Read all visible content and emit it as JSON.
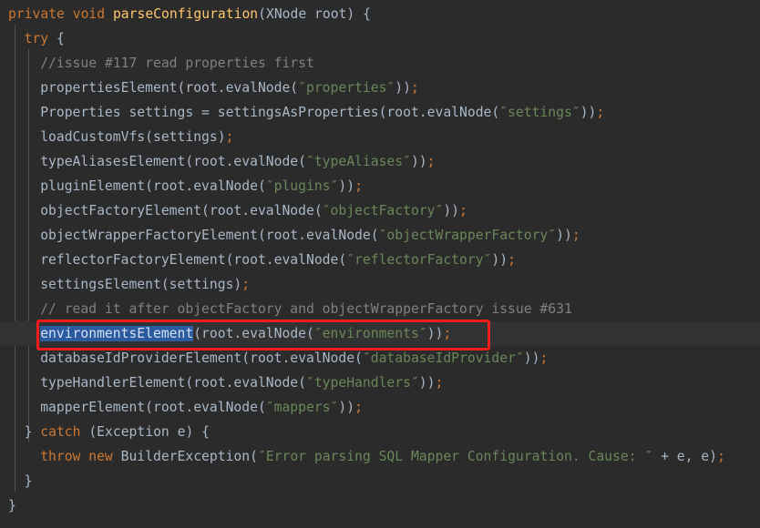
{
  "editor": {
    "theme": "darcula",
    "language": "java",
    "background_color": "#2b2b2b",
    "current_line_color": "#323232",
    "selection_color": "#2b5b9e",
    "annotation_color": "#f01d1d",
    "lines": [
      {
        "indent": 0,
        "tokens": [
          {
            "text": "private",
            "kind": "keyword"
          },
          {
            "text": " ",
            "kind": "plain"
          },
          {
            "text": "void",
            "kind": "keyword"
          },
          {
            "text": " ",
            "kind": "plain"
          },
          {
            "text": "parseConfiguration",
            "kind": "function"
          },
          {
            "text": "(XNode root) {",
            "kind": "plain"
          }
        ]
      },
      {
        "indent": 1,
        "tokens": [
          {
            "text": "try",
            "kind": "keyword"
          },
          {
            "text": " {",
            "kind": "plain"
          }
        ]
      },
      {
        "indent": 2,
        "tokens": [
          {
            "text": "//issue #117 read properties first",
            "kind": "comment"
          }
        ]
      },
      {
        "indent": 2,
        "tokens": [
          {
            "text": "propertiesElement(root.evalNode(",
            "kind": "plain"
          },
          {
            "text": "″properties″",
            "kind": "string"
          },
          {
            "text": "))",
            "kind": "plain"
          },
          {
            "text": ";",
            "kind": "semicolon"
          }
        ]
      },
      {
        "indent": 2,
        "tokens": [
          {
            "text": "Properties settings = settingsAsProperties(root.evalNode(",
            "kind": "plain"
          },
          {
            "text": "″settings″",
            "kind": "string"
          },
          {
            "text": "))",
            "kind": "plain"
          },
          {
            "text": ";",
            "kind": "semicolon"
          }
        ]
      },
      {
        "indent": 2,
        "tokens": [
          {
            "text": "loadCustomVfs(settings)",
            "kind": "plain"
          },
          {
            "text": ";",
            "kind": "semicolon"
          }
        ]
      },
      {
        "indent": 2,
        "tokens": [
          {
            "text": "typeAliasesElement(root.evalNode(",
            "kind": "plain"
          },
          {
            "text": "″typeAliases″",
            "kind": "string"
          },
          {
            "text": "))",
            "kind": "plain"
          },
          {
            "text": ";",
            "kind": "semicolon"
          }
        ]
      },
      {
        "indent": 2,
        "tokens": [
          {
            "text": "pluginElement(root.evalNode(",
            "kind": "plain"
          },
          {
            "text": "″plugins″",
            "kind": "string"
          },
          {
            "text": "))",
            "kind": "plain"
          },
          {
            "text": ";",
            "kind": "semicolon"
          }
        ]
      },
      {
        "indent": 2,
        "tokens": [
          {
            "text": "objectFactoryElement(root.evalNode(",
            "kind": "plain"
          },
          {
            "text": "″objectFactory″",
            "kind": "string"
          },
          {
            "text": "))",
            "kind": "plain"
          },
          {
            "text": ";",
            "kind": "semicolon"
          }
        ]
      },
      {
        "indent": 2,
        "tokens": [
          {
            "text": "objectWrapperFactoryElement(root.evalNode(",
            "kind": "plain"
          },
          {
            "text": "″objectWrapperFactory″",
            "kind": "string"
          },
          {
            "text": "))",
            "kind": "plain"
          },
          {
            "text": ";",
            "kind": "semicolon"
          }
        ]
      },
      {
        "indent": 2,
        "tokens": [
          {
            "text": "reflectorFactoryElement(root.evalNode(",
            "kind": "plain"
          },
          {
            "text": "″reflectorFactory″",
            "kind": "string"
          },
          {
            "text": "))",
            "kind": "plain"
          },
          {
            "text": ";",
            "kind": "semicolon"
          }
        ]
      },
      {
        "indent": 2,
        "tokens": [
          {
            "text": "settingsElement(settings)",
            "kind": "plain"
          },
          {
            "text": ";",
            "kind": "semicolon"
          }
        ]
      },
      {
        "indent": 2,
        "tokens": [
          {
            "text": "// read it after objectFactory and objectWrapperFactory issue #631",
            "kind": "comment"
          }
        ]
      },
      {
        "indent": 2,
        "current": true,
        "tokens": [
          {
            "text": "environmentsElement",
            "kind": "selected"
          },
          {
            "text": "(root.evalNode(",
            "kind": "plain"
          },
          {
            "text": "″environments″",
            "kind": "string"
          },
          {
            "text": "))",
            "kind": "plain"
          },
          {
            "text": ";",
            "kind": "semicolon"
          }
        ]
      },
      {
        "indent": 2,
        "tokens": [
          {
            "text": "databaseIdProviderElement(root.evalNode(",
            "kind": "plain"
          },
          {
            "text": "″databaseIdProvider″",
            "kind": "string"
          },
          {
            "text": "))",
            "kind": "plain"
          },
          {
            "text": ";",
            "kind": "semicolon"
          }
        ]
      },
      {
        "indent": 2,
        "tokens": [
          {
            "text": "typeHandlerElement(root.evalNode(",
            "kind": "plain"
          },
          {
            "text": "″typeHandlers″",
            "kind": "string"
          },
          {
            "text": "))",
            "kind": "plain"
          },
          {
            "text": ";",
            "kind": "semicolon"
          }
        ]
      },
      {
        "indent": 2,
        "tokens": [
          {
            "text": "mapperElement(root.evalNode(",
            "kind": "plain"
          },
          {
            "text": "″mappers″",
            "kind": "string"
          },
          {
            "text": "))",
            "kind": "plain"
          },
          {
            "text": ";",
            "kind": "semicolon"
          }
        ]
      },
      {
        "indent": 1,
        "tokens": [
          {
            "text": "} ",
            "kind": "plain"
          },
          {
            "text": "catch",
            "kind": "keyword"
          },
          {
            "text": " (Exception e) {",
            "kind": "plain"
          }
        ]
      },
      {
        "indent": 2,
        "tokens": [
          {
            "text": "throw",
            "kind": "keyword"
          },
          {
            "text": " ",
            "kind": "plain"
          },
          {
            "text": "new",
            "kind": "keyword"
          },
          {
            "text": " BuilderException(",
            "kind": "plain"
          },
          {
            "text": "″Error parsing SQL Mapper Configuration. Cause: ″",
            "kind": "string"
          },
          {
            "text": " + e, e)",
            "kind": "plain"
          },
          {
            "text": ";",
            "kind": "semicolon"
          }
        ]
      },
      {
        "indent": 1,
        "tokens": [
          {
            "text": "}",
            "kind": "plain"
          }
        ]
      },
      {
        "indent": 0,
        "tokens": [
          {
            "text": "}",
            "kind": "plain"
          }
        ]
      }
    ],
    "annotation": {
      "shape": "rectangle",
      "target_line_index": 13,
      "target_text": "environmentsElement(root.evalNode(″environments″));"
    }
  }
}
